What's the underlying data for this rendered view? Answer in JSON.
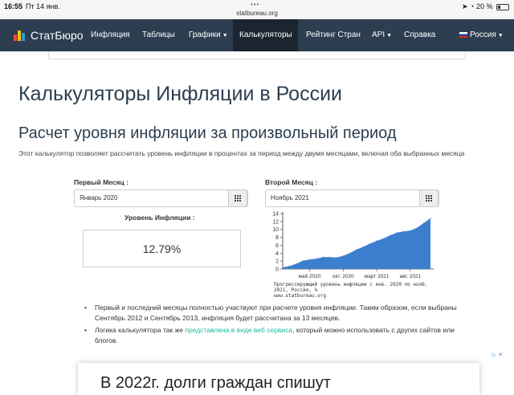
{
  "status_bar": {
    "time": "16:55",
    "date": "Пт 14 янв.",
    "url": "statbureau.org",
    "battery_percent": "20 %"
  },
  "navbar": {
    "brand": "СтатБюро",
    "items": [
      {
        "label": "Инфляция",
        "dropdown": false,
        "active": false
      },
      {
        "label": "Таблицы",
        "dropdown": false,
        "active": false
      },
      {
        "label": "Графики",
        "dropdown": true,
        "active": false
      },
      {
        "label": "Калькуляторы",
        "dropdown": false,
        "active": true
      },
      {
        "label": "Рейтинг Стран",
        "dropdown": false,
        "active": false
      },
      {
        "label": "API",
        "dropdown": true,
        "active": false
      },
      {
        "label": "Справка",
        "dropdown": false,
        "active": false
      }
    ],
    "language": "Россия",
    "colors": {
      "background": "#2c3e50",
      "active": "#1a252f"
    }
  },
  "page": {
    "title": "Калькуляторы Инфляции в России",
    "subtitle": "Расчет уровня инфляции за произвольный период",
    "description": "Этот калькулятор позволяет рассчитать уровень инфляции в процентах за период между двумя месяцами, включая оба выбранных месяца"
  },
  "form": {
    "first_month_label": "Первый Месяц :",
    "first_month_value": "Январь 2020",
    "second_month_label": "Второй Месяц :",
    "second_month_value": "Ноябрь 2021",
    "result_label": "Уровень Инфляции :",
    "result_value": "12.79%"
  },
  "chart_data": {
    "type": "area",
    "x": [
      "2020-01",
      "2020-02",
      "2020-03",
      "2020-04",
      "2020-05",
      "2020-06",
      "2020-07",
      "2020-08",
      "2020-09",
      "2020-10",
      "2020-11",
      "2020-12",
      "2021-01",
      "2021-02",
      "2021-03",
      "2021-04",
      "2021-05",
      "2021-06",
      "2021-07",
      "2021-08",
      "2021-09",
      "2021-10",
      "2021-11"
    ],
    "values": [
      0.4,
      0.7,
      1.3,
      2.1,
      2.4,
      2.6,
      3.0,
      3.0,
      2.9,
      3.3,
      4.0,
      4.9,
      5.6,
      6.4,
      7.1,
      7.7,
      8.5,
      9.2,
      9.5,
      9.7,
      10.4,
      11.6,
      12.8
    ],
    "xticks": [
      {
        "x": "2020-05",
        "label": "май 2020"
      },
      {
        "x": "2020-10",
        "label": "окт. 2020"
      },
      {
        "x": "2021-03",
        "label": "март 2021"
      },
      {
        "x": "2021-08",
        "label": "авг. 2021"
      }
    ],
    "yticks": [
      0,
      2,
      4,
      6,
      8,
      10,
      12,
      14
    ],
    "ylim": [
      0,
      14
    ],
    "grid": false,
    "color": "#3d7fcf",
    "caption": [
      "Прогрессирующий уровень инфляции с янв. 2020 по нояб.",
      "2021, Россия, %",
      "www.statbureau.org"
    ]
  },
  "bullets": [
    {
      "text": "Первый и последний месяцы полностью участвуют при расчете уровня инфляции. Таким образом, если выбраны Сентябрь 2012 и Сентябрь 2013, инфляция будет рассчитана за 13 месяцев."
    },
    {
      "prefix": "Логика калькулятора так же ",
      "link": "представлена в виде веб сервиса",
      "suffix": ", который можно использовать с других сайтов или блогов."
    }
  ],
  "ad": {
    "text": "В 2022г. долги граждан спишут"
  }
}
